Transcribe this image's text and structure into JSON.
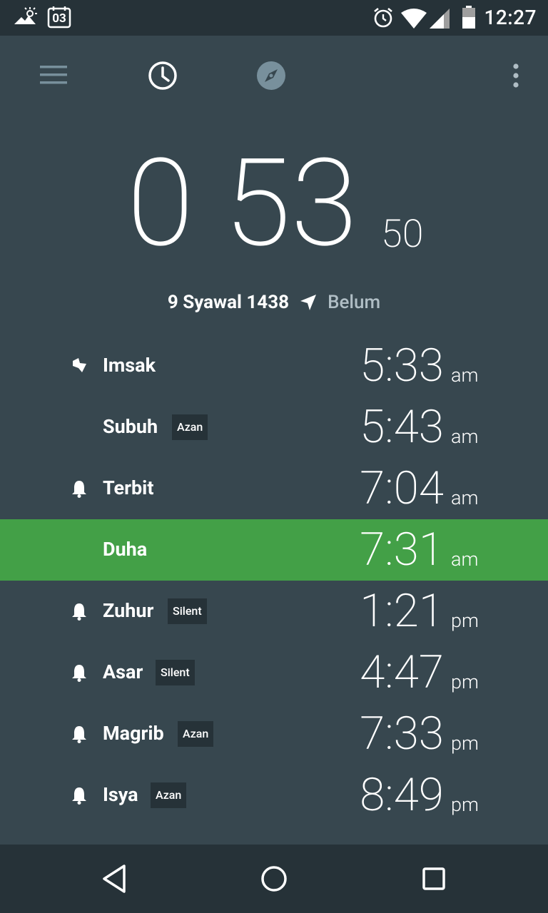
{
  "status_bar": {
    "time": "12:27",
    "calendar_day": "03",
    "icons": [
      "weather-sunny-icon",
      "calendar-icon",
      "alarm-icon",
      "wifi-icon",
      "signal-icon",
      "battery-icon"
    ]
  },
  "toolbar": {
    "icons": [
      "menu-icon",
      "clock-icon",
      "compass-icon",
      "overflow-icon"
    ]
  },
  "countdown": {
    "hours": "0",
    "minutes": "53",
    "seconds": "50"
  },
  "date": {
    "hijri": "9 Syawal 1438",
    "location": "Belum"
  },
  "prayers": [
    {
      "name": "Imsak",
      "time": "5:33",
      "ampm": "am",
      "badge": "",
      "icon": "imsak-icon"
    },
    {
      "name": "Subuh",
      "time": "5:43",
      "ampm": "am",
      "badge": "Azan",
      "icon": ""
    },
    {
      "name": "Terbit",
      "time": "7:04",
      "ampm": "am",
      "badge": "",
      "icon": "bell-icon"
    },
    {
      "name": "Duha",
      "time": "7:31",
      "ampm": "am",
      "badge": "",
      "icon": "",
      "active": true
    },
    {
      "name": "Zuhur",
      "time": "1:21",
      "ampm": "pm",
      "badge": "Silent",
      "icon": "bell-icon"
    },
    {
      "name": "Asar",
      "time": "4:47",
      "ampm": "pm",
      "badge": "Silent",
      "icon": "bell-icon"
    },
    {
      "name": "Magrib",
      "time": "7:33",
      "ampm": "pm",
      "badge": "Azan",
      "icon": "bell-icon"
    },
    {
      "name": "Isya",
      "time": "8:49",
      "ampm": "pm",
      "badge": "Azan",
      "icon": "bell-icon"
    }
  ],
  "colors": {
    "background": "#37474F",
    "bars": "#263238",
    "active_row": "#43A047",
    "badge": "#263238"
  },
  "nav_bar": {
    "icons": [
      "back-icon",
      "home-icon",
      "recents-icon"
    ]
  }
}
